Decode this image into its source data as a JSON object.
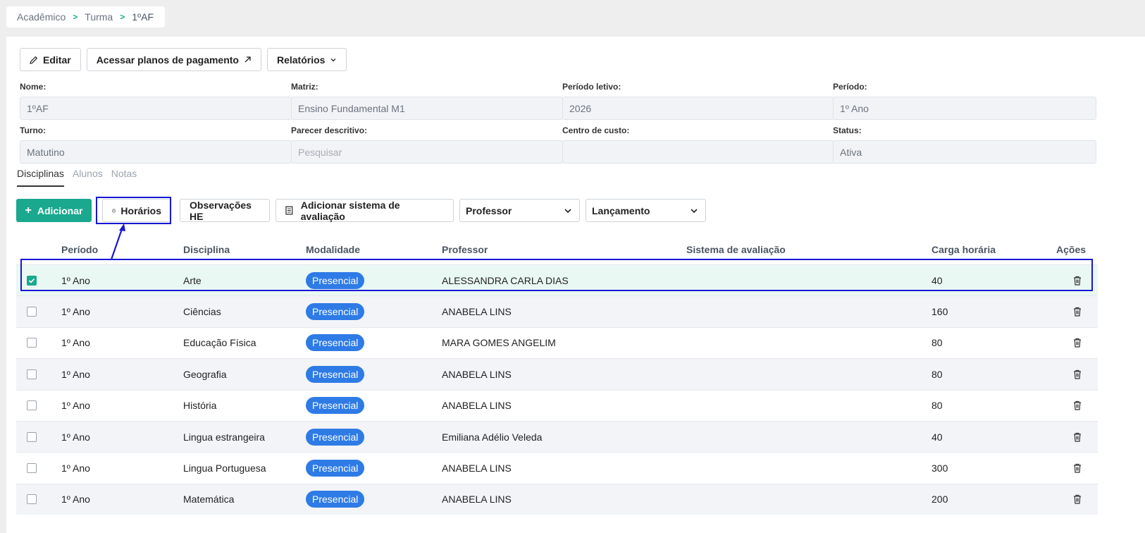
{
  "breadcrumb": [
    "Acadêmico",
    "Turma",
    "1ºAF"
  ],
  "toolbar": {
    "edit_label": "Editar",
    "payment_label": "Acessar planos de pagamento",
    "reports_label": "Relatórios"
  },
  "fields": [
    {
      "label": "Nome:",
      "value": "1ºAF",
      "placeholder": false
    },
    {
      "label": "Matriz:",
      "value": "Ensino Fundamental M1",
      "placeholder": false
    },
    {
      "label": "Período letivo:",
      "value": "2026",
      "placeholder": false
    },
    {
      "label": "Período:",
      "value": "1º Ano",
      "placeholder": false
    },
    {
      "label": "Turno:",
      "value": "Matutino",
      "placeholder": false
    },
    {
      "label": "Parecer descritivo:",
      "value": "Pesquisar",
      "placeholder": true
    },
    {
      "label": "Centro de custo:",
      "value": "",
      "placeholder": false
    },
    {
      "label": "Status:",
      "value": "Ativa",
      "placeholder": false
    }
  ],
  "tabs": [
    {
      "label": "Disciplinas",
      "active": true
    },
    {
      "label": "Alunos",
      "active": false
    },
    {
      "label": "Notas",
      "active": false
    }
  ],
  "actions": {
    "add_label": "Adicionar",
    "schedule_label": "Horários",
    "notes_label": "Observações HE",
    "eval_label": "Adicionar sistema de avaliação",
    "professor_select": "Professor",
    "launch_select": "Lançamento"
  },
  "table": {
    "headers": [
      "Período",
      "Disciplina",
      "Modalidade",
      "Professor",
      "Sistema de avaliação",
      "Carga horária",
      "Ações"
    ],
    "rows": [
      {
        "periodo": "1º Ano",
        "disciplina": "Arte",
        "modalidade": "Presencial",
        "professor": "ALESSANDRA CARLA DIAS",
        "sistema": "",
        "carga": "40",
        "checked": true
      },
      {
        "periodo": "1º Ano",
        "disciplina": "Ciências",
        "modalidade": "Presencial",
        "professor": "ANABELA LINS",
        "sistema": "",
        "carga": "160",
        "checked": false
      },
      {
        "periodo": "1º Ano",
        "disciplina": "Educação Física",
        "modalidade": "Presencial",
        "professor": "MARA GOMES ANGELIM",
        "sistema": "",
        "carga": "80",
        "checked": false
      },
      {
        "periodo": "1º Ano",
        "disciplina": "Geografia",
        "modalidade": "Presencial",
        "professor": "ANABELA LINS",
        "sistema": "",
        "carga": "80",
        "checked": false
      },
      {
        "periodo": "1º Ano",
        "disciplina": "História",
        "modalidade": "Presencial",
        "professor": "ANABELA LINS",
        "sistema": "",
        "carga": "80",
        "checked": false
      },
      {
        "periodo": "1º Ano",
        "disciplina": "Lingua estrangeira",
        "modalidade": "Presencial",
        "professor": "Emiliana Adélio Veleda",
        "sistema": "",
        "carga": "40",
        "checked": false
      },
      {
        "periodo": "1º Ano",
        "disciplina": "Lingua Portuguesa",
        "modalidade": "Presencial",
        "professor": "ANABELA LINS",
        "sistema": "",
        "carga": "300",
        "checked": false
      },
      {
        "periodo": "1º Ano",
        "disciplina": "Matemática",
        "modalidade": "Presencial",
        "professor": "ANABELA LINS",
        "sistema": "",
        "carga": "200",
        "checked": false
      }
    ]
  },
  "colors": {
    "accent": "#1aa88e",
    "pill": "#2e7be6",
    "annotation": "#1717d6"
  }
}
